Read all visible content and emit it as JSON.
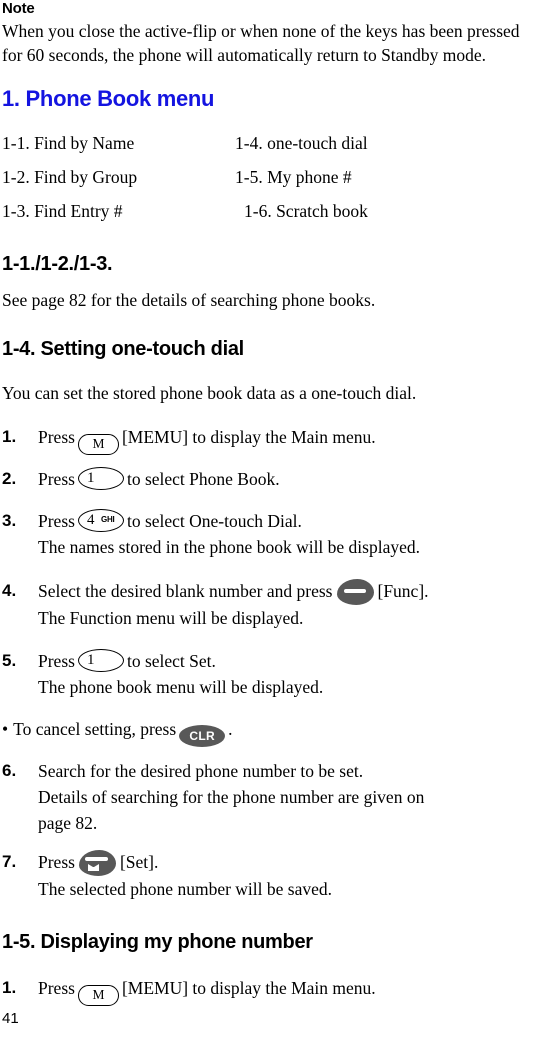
{
  "note": {
    "title": "Note",
    "line1": "When you close the active-flip or when none of the keys has been pressed",
    "line2": "for 60 seconds, the phone will automatically return to Standby mode."
  },
  "section_heading": "1. Phone Book menu",
  "menu_list": {
    "left": [
      "1-1. Find by Name",
      "1-2. Find by Group",
      "1-3. Find Entry #"
    ],
    "right": [
      "1-4. one-touch dial",
      "1-5. My phone #",
      "1-6. Scratch book"
    ]
  },
  "sub_113": {
    "heading": "1-1./1-2./1-3.",
    "body": "See page 82 for the details of searching phone books."
  },
  "sub_14": {
    "heading": "1-4. Setting one-touch dial",
    "intro": "You can set the stored phone book data as a one-touch dial.",
    "steps": [
      {
        "num": "1.",
        "pre": "Press",
        "key": "menu-key",
        "key_label": "M",
        "post": "[MEMU] to display the Main menu.",
        "extra": ""
      },
      {
        "num": "2.",
        "pre": "Press",
        "key": "digit-1-key",
        "key_label": "1",
        "key_sub": "",
        "post": "to select Phone Book.",
        "extra": ""
      },
      {
        "num": "3.",
        "pre": "Press",
        "key": "digit-4-ghi-key",
        "key_label": "4",
        "key_sub": "GHI",
        "post": "to select One-touch Dial.",
        "extra": "The names stored in the phone book will be displayed."
      },
      {
        "num": "4.",
        "pre": "Select the desired blank number and press",
        "key": "func-soft-key",
        "post": "[Func].",
        "extra": "The Function menu will be displayed."
      },
      {
        "num": "5.",
        "pre": "Press",
        "key": "digit-1-key",
        "key_label": "1",
        "key_sub": "",
        "post": "to select Set.",
        "extra": "The phone book menu will be displayed."
      },
      {
        "num": "6.",
        "pre": "Search for the desired phone number to be set.",
        "key": "",
        "post": "",
        "extra": "Details of searching for the phone number are given on",
        "extra2": "page 82."
      },
      {
        "num": "7.",
        "pre": "Press",
        "key": "set-soft-key",
        "post": "[Set].",
        "extra": "The selected phone number will be saved."
      }
    ],
    "cancel_note": {
      "bullet": "•",
      "pre": "To cancel setting, press",
      "key_label": "CLR",
      "post": "."
    }
  },
  "sub_15": {
    "heading": "1-5. Displaying my phone number",
    "step1": {
      "num": "1.",
      "pre": "Press",
      "key_label": "M",
      "post": "[MEMU] to display the Main menu."
    }
  },
  "page_number": "41",
  "colors": {
    "heading_blue": "#1414e0",
    "key_dark": "#585858",
    "text": "#000000"
  }
}
